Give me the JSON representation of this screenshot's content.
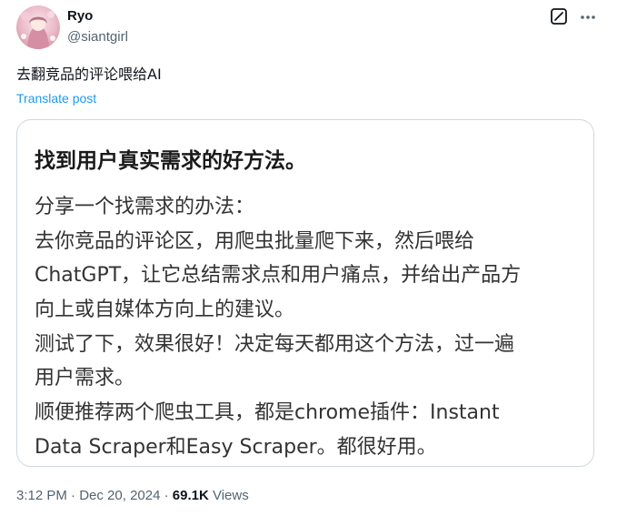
{
  "author": {
    "display_name": "Ryo",
    "handle": "@siantgirl"
  },
  "icons": {
    "avatar": "avatar-photo",
    "grok": "grok-icon",
    "more": "more-icon"
  },
  "tweet": {
    "text": "去翻竞品的评论喂给AI",
    "translate_label": "Translate post"
  },
  "media": {
    "title": "找到用户真实需求的好方法。",
    "lines": [
      "分享一个找需求的办法：",
      "去你竞品的评论区，用爬虫批量爬下来，然后喂给",
      "ChatGPT，让它总结需求点和用户痛点，并给出产品方",
      "向上或自媒体方向上的建议。",
      "测试了下，效果很好！决定每天都用这个方法，过一遍",
      "用户需求。",
      "顺便推荐两个爬虫工具，都是chrome插件：Instant",
      "Data Scraper和Easy Scraper。都很好用。"
    ]
  },
  "meta": {
    "time": "3:12 PM",
    "separator1": " · ",
    "date": "Dec 20, 2024",
    "separator2": " · ",
    "views_count": "69.1K",
    "views_label": " Views"
  },
  "colors": {
    "text_primary": "#0f1419",
    "text_secondary": "#536471",
    "link": "#1d9bf0",
    "border": "#cfd9de"
  }
}
